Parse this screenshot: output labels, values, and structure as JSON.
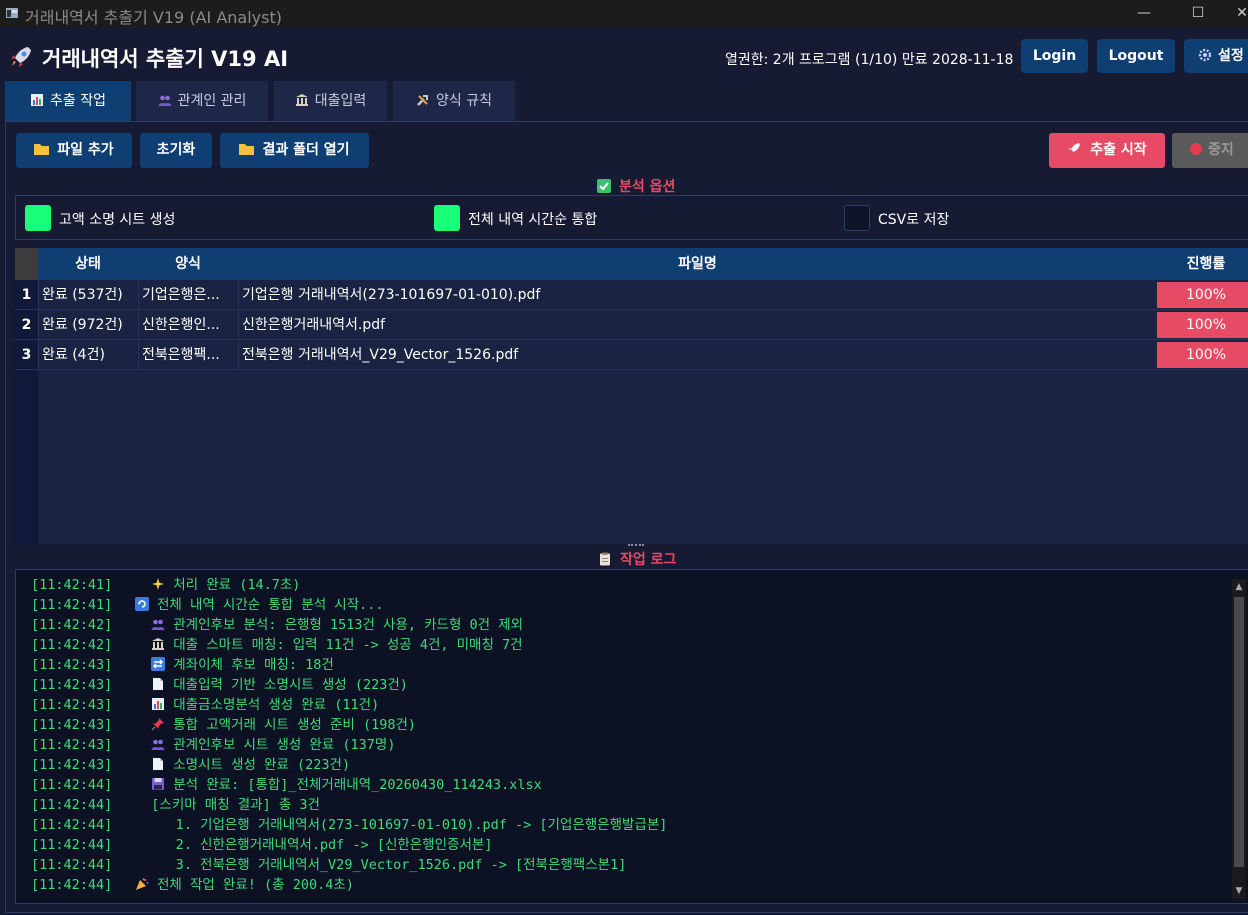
{
  "window": {
    "title": "거래내역서 추출기 V19 (AI Analyst)",
    "min_glyph": "—",
    "max_glyph": "☐",
    "close_glyph": "✕"
  },
  "header": {
    "app_title": "거래내역서 추출기 V19 AI",
    "license": "열권한: 2개 프로그램 (1/10) 만료 2028-11-18",
    "login_label": "Login",
    "logout_label": "Logout",
    "settings_label": "설정"
  },
  "tabs": [
    {
      "label": "추출 작업",
      "icon": "chart-icon",
      "active": true
    },
    {
      "label": "관계인 관리",
      "icon": "people-icon",
      "active": false
    },
    {
      "label": "대출입력",
      "icon": "bank-icon",
      "active": false
    },
    {
      "label": "양식 규칙",
      "icon": "tools-icon",
      "active": false
    }
  ],
  "toolbar": {
    "add_files": "파일 추가",
    "reset": "초기화",
    "open_folder": "결과 폴더 열기",
    "start": "추출 시작",
    "stop": "중지"
  },
  "options": {
    "title": "분석 옵션",
    "items": [
      {
        "label": "고액 소명 시트 생성",
        "checked": true
      },
      {
        "label": "전체 내역 시간순 통합",
        "checked": true
      },
      {
        "label": "CSV로 저장",
        "checked": false
      }
    ]
  },
  "table": {
    "headers": {
      "status": "상태",
      "form": "양식",
      "file": "파일명",
      "progress": "진행률"
    },
    "rows": [
      {
        "num": "1",
        "status": "완료 (537건)",
        "form": "기업은행은...",
        "file": "기업은행 거래내역서(273-101697-01-010).pdf",
        "progress": "100%"
      },
      {
        "num": "2",
        "status": "완료 (972건)",
        "form": "신한은행인...",
        "file": "신한은행거래내역서.pdf",
        "progress": "100%"
      },
      {
        "num": "3",
        "status": "완료 (4건)",
        "form": "전북은행팩...",
        "file": "전북은행 거래내역서_V29_Vector_1526.pdf",
        "progress": "100%"
      }
    ]
  },
  "log": {
    "title": "작업 로그",
    "lines": [
      {
        "ts": "[11:42:41]",
        "icon": "sparkle-icon",
        "indent": "  ",
        "text": "처리 완료 (14.7초)"
      },
      {
        "ts": "[11:42:41]",
        "icon": "refresh-icon",
        "indent": "",
        "text": "전체 내역 시간순 통합 분석 시작..."
      },
      {
        "ts": "[11:42:42]",
        "icon": "people-icon",
        "indent": "  ",
        "text": "관계인후보 분석: 은행형 1513건 사용, 카드형 0건 제외"
      },
      {
        "ts": "[11:42:42]",
        "icon": "bank-icon",
        "indent": "  ",
        "text": "대출 스마트 매칭: 입력 11건 -> 성공 4건, 미매칭 7건"
      },
      {
        "ts": "[11:42:43]",
        "icon": "transfer-icon",
        "indent": "  ",
        "text": "계좌이체 후보 매칭: 18건"
      },
      {
        "ts": "[11:42:43]",
        "icon": "document-icon",
        "indent": "  ",
        "text": "대출입력 기반 소명시트 생성 (223건)"
      },
      {
        "ts": "[11:42:43]",
        "icon": "chart-icon",
        "indent": "  ",
        "text": "대출금소명분석 생성 완료 (11건)"
      },
      {
        "ts": "[11:42:43]",
        "icon": "pin-icon",
        "indent": "  ",
        "text": "통합 고액거래 시트 생성 준비 (198건)"
      },
      {
        "ts": "[11:42:43]",
        "icon": "people-icon",
        "indent": "  ",
        "text": "관계인후보 시트 생성 완료 (137명)"
      },
      {
        "ts": "[11:42:43]",
        "icon": "document-icon",
        "indent": "  ",
        "text": "소명시트 생성 완료 (223건)"
      },
      {
        "ts": "[11:42:44]",
        "icon": "save-icon",
        "indent": "  ",
        "text": "분석 완료: [통합]_전체거래내역_20260430_114243.xlsx"
      },
      {
        "ts": "[11:42:44]",
        "icon": "",
        "indent": "  ",
        "text": "[스키마 매칭 결과] 총 3건"
      },
      {
        "ts": "[11:42:44]",
        "icon": "",
        "indent": "     ",
        "text": "1. 기업은행 거래내역서(273-101697-01-010).pdf -> [기업은행은행발급본]"
      },
      {
        "ts": "[11:42:44]",
        "icon": "",
        "indent": "     ",
        "text": "2. 신한은행거래내역서.pdf -> [신한은행인증서본]"
      },
      {
        "ts": "[11:42:44]",
        "icon": "",
        "indent": "     ",
        "text": "3. 전북은행 거래내역서_V29_Vector_1526.pdf -> [전북은행팩스본1]"
      },
      {
        "ts": "[11:42:44]",
        "icon": "party-icon",
        "indent": "",
        "text": "전체 작업 완료! (총 200.4초)"
      }
    ]
  }
}
